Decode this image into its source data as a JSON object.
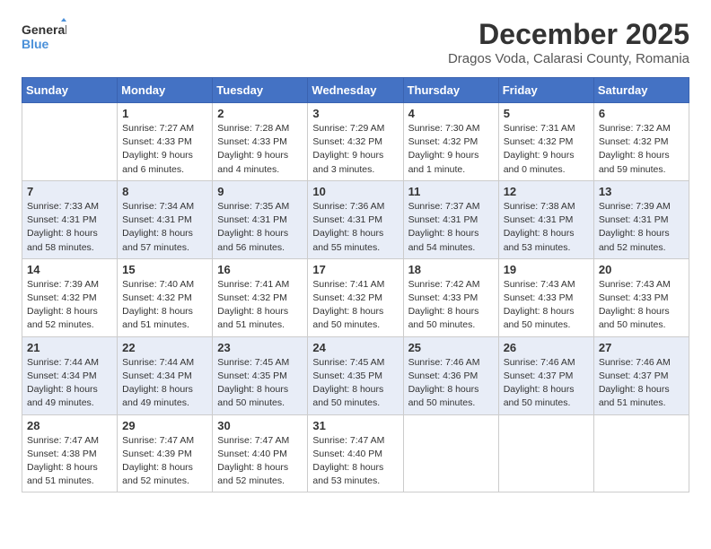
{
  "logo": {
    "line1": "General",
    "line2": "Blue"
  },
  "title": "December 2025",
  "subtitle": "Dragos Voda, Calarasi County, Romania",
  "days_of_week": [
    "Sunday",
    "Monday",
    "Tuesday",
    "Wednesday",
    "Thursday",
    "Friday",
    "Saturday"
  ],
  "weeks": [
    [
      {
        "day": "",
        "info": ""
      },
      {
        "day": "1",
        "info": "Sunrise: 7:27 AM\nSunset: 4:33 PM\nDaylight: 9 hours\nand 6 minutes."
      },
      {
        "day": "2",
        "info": "Sunrise: 7:28 AM\nSunset: 4:33 PM\nDaylight: 9 hours\nand 4 minutes."
      },
      {
        "day": "3",
        "info": "Sunrise: 7:29 AM\nSunset: 4:32 PM\nDaylight: 9 hours\nand 3 minutes."
      },
      {
        "day": "4",
        "info": "Sunrise: 7:30 AM\nSunset: 4:32 PM\nDaylight: 9 hours\nand 1 minute."
      },
      {
        "day": "5",
        "info": "Sunrise: 7:31 AM\nSunset: 4:32 PM\nDaylight: 9 hours\nand 0 minutes."
      },
      {
        "day": "6",
        "info": "Sunrise: 7:32 AM\nSunset: 4:32 PM\nDaylight: 8 hours\nand 59 minutes."
      }
    ],
    [
      {
        "day": "7",
        "info": "Sunrise: 7:33 AM\nSunset: 4:31 PM\nDaylight: 8 hours\nand 58 minutes."
      },
      {
        "day": "8",
        "info": "Sunrise: 7:34 AM\nSunset: 4:31 PM\nDaylight: 8 hours\nand 57 minutes."
      },
      {
        "day": "9",
        "info": "Sunrise: 7:35 AM\nSunset: 4:31 PM\nDaylight: 8 hours\nand 56 minutes."
      },
      {
        "day": "10",
        "info": "Sunrise: 7:36 AM\nSunset: 4:31 PM\nDaylight: 8 hours\nand 55 minutes."
      },
      {
        "day": "11",
        "info": "Sunrise: 7:37 AM\nSunset: 4:31 PM\nDaylight: 8 hours\nand 54 minutes."
      },
      {
        "day": "12",
        "info": "Sunrise: 7:38 AM\nSunset: 4:31 PM\nDaylight: 8 hours\nand 53 minutes."
      },
      {
        "day": "13",
        "info": "Sunrise: 7:39 AM\nSunset: 4:31 PM\nDaylight: 8 hours\nand 52 minutes."
      }
    ],
    [
      {
        "day": "14",
        "info": "Sunrise: 7:39 AM\nSunset: 4:32 PM\nDaylight: 8 hours\nand 52 minutes."
      },
      {
        "day": "15",
        "info": "Sunrise: 7:40 AM\nSunset: 4:32 PM\nDaylight: 8 hours\nand 51 minutes."
      },
      {
        "day": "16",
        "info": "Sunrise: 7:41 AM\nSunset: 4:32 PM\nDaylight: 8 hours\nand 51 minutes."
      },
      {
        "day": "17",
        "info": "Sunrise: 7:41 AM\nSunset: 4:32 PM\nDaylight: 8 hours\nand 50 minutes."
      },
      {
        "day": "18",
        "info": "Sunrise: 7:42 AM\nSunset: 4:33 PM\nDaylight: 8 hours\nand 50 minutes."
      },
      {
        "day": "19",
        "info": "Sunrise: 7:43 AM\nSunset: 4:33 PM\nDaylight: 8 hours\nand 50 minutes."
      },
      {
        "day": "20",
        "info": "Sunrise: 7:43 AM\nSunset: 4:33 PM\nDaylight: 8 hours\nand 50 minutes."
      }
    ],
    [
      {
        "day": "21",
        "info": "Sunrise: 7:44 AM\nSunset: 4:34 PM\nDaylight: 8 hours\nand 49 minutes."
      },
      {
        "day": "22",
        "info": "Sunrise: 7:44 AM\nSunset: 4:34 PM\nDaylight: 8 hours\nand 49 minutes."
      },
      {
        "day": "23",
        "info": "Sunrise: 7:45 AM\nSunset: 4:35 PM\nDaylight: 8 hours\nand 50 minutes."
      },
      {
        "day": "24",
        "info": "Sunrise: 7:45 AM\nSunset: 4:35 PM\nDaylight: 8 hours\nand 50 minutes."
      },
      {
        "day": "25",
        "info": "Sunrise: 7:46 AM\nSunset: 4:36 PM\nDaylight: 8 hours\nand 50 minutes."
      },
      {
        "day": "26",
        "info": "Sunrise: 7:46 AM\nSunset: 4:37 PM\nDaylight: 8 hours\nand 50 minutes."
      },
      {
        "day": "27",
        "info": "Sunrise: 7:46 AM\nSunset: 4:37 PM\nDaylight: 8 hours\nand 51 minutes."
      }
    ],
    [
      {
        "day": "28",
        "info": "Sunrise: 7:47 AM\nSunset: 4:38 PM\nDaylight: 8 hours\nand 51 minutes."
      },
      {
        "day": "29",
        "info": "Sunrise: 7:47 AM\nSunset: 4:39 PM\nDaylight: 8 hours\nand 52 minutes."
      },
      {
        "day": "30",
        "info": "Sunrise: 7:47 AM\nSunset: 4:40 PM\nDaylight: 8 hours\nand 52 minutes."
      },
      {
        "day": "31",
        "info": "Sunrise: 7:47 AM\nSunset: 4:40 PM\nDaylight: 8 hours\nand 53 minutes."
      },
      {
        "day": "",
        "info": ""
      },
      {
        "day": "",
        "info": ""
      },
      {
        "day": "",
        "info": ""
      }
    ]
  ]
}
